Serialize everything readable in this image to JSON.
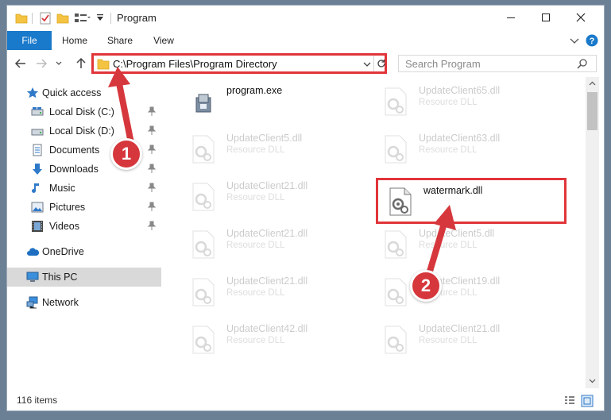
{
  "window": {
    "title": "Program"
  },
  "ribbon": {
    "file": "File",
    "home": "Home",
    "share": "Share",
    "view": "View"
  },
  "address": {
    "path": "C:\\Program Files\\Program Directory"
  },
  "search": {
    "placeholder": "Search Program"
  },
  "sidebar": {
    "items": [
      {
        "label": "Quick access",
        "icon": "star-icon"
      },
      {
        "label": "Local Disk (C:)",
        "icon": "drive-icon"
      },
      {
        "label": "Local Disk (D:)",
        "icon": "drive-icon"
      },
      {
        "label": "Documents",
        "icon": "documents-icon"
      },
      {
        "label": "Downloads",
        "icon": "download-icon"
      },
      {
        "label": "Music",
        "icon": "music-icon"
      },
      {
        "label": "Pictures",
        "icon": "pictures-icon"
      },
      {
        "label": "Videos",
        "icon": "videos-icon"
      },
      {
        "label": "OneDrive",
        "icon": "cloud-icon"
      },
      {
        "label": "This PC",
        "icon": "computer-icon"
      },
      {
        "label": "Network",
        "icon": "network-icon"
      }
    ]
  },
  "files": [
    {
      "name": "program.exe",
      "type": "",
      "icon": "exe-icon"
    },
    {
      "name": "UpdateClient65.dll",
      "type": "Resource DLL",
      "icon": "dll-icon"
    },
    {
      "name": "UpdateClient5.dll",
      "type": "Resource DLL",
      "icon": "dll-icon"
    },
    {
      "name": "UpdateClient63.dll",
      "type": "Resource DLL",
      "icon": "dll-icon"
    },
    {
      "name": "UpdateClient21.dll",
      "type": "Resource DLL",
      "icon": "dll-icon"
    },
    {
      "name": "watermark.dll",
      "type": "",
      "icon": "dll-icon"
    },
    {
      "name": "UpdateClient21.dll",
      "type": "Resource DLL",
      "icon": "dll-icon"
    },
    {
      "name": "UpdateClient5.dll",
      "type": "Resource DLL",
      "icon": "dll-icon"
    },
    {
      "name": "UpdateClient21.dll",
      "type": "Resource DLL",
      "icon": "dll-icon"
    },
    {
      "name": "UpdateClient19.dll",
      "type": "Resource DLL",
      "icon": "dll-icon"
    },
    {
      "name": "UpdateClient42.dll",
      "type": "Resource DLL",
      "icon": "dll-icon"
    },
    {
      "name": "UpdateClient21.dll",
      "type": "Resource DLL",
      "icon": "dll-icon"
    }
  ],
  "status": {
    "count": "116 items"
  },
  "annotations": {
    "step1": "1",
    "step2": "2",
    "color": "#d6373c"
  }
}
